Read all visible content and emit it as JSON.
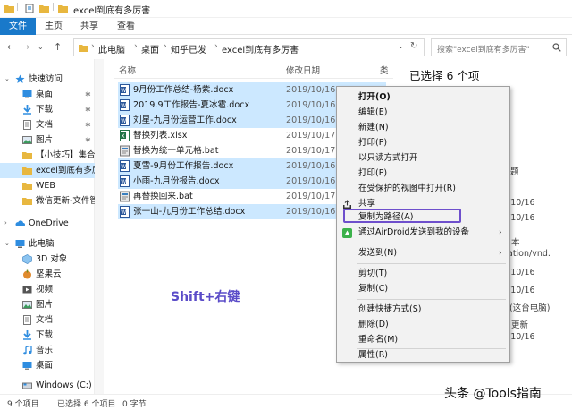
{
  "window": {
    "title": "excel到底有多厉害"
  },
  "ribbon": {
    "tabs": [
      "文件",
      "主页",
      "共享",
      "查看"
    ]
  },
  "address": {
    "crumbs": [
      "此电脑",
      "桌面",
      "知乎已发",
      "excel到底有多厉害"
    ],
    "search_placeholder": "搜索\"excel到底有多厉害\""
  },
  "nav": {
    "items": [
      {
        "label": "快速访问",
        "icon": "star-icon"
      },
      {
        "label": "桌面",
        "icon": "desktop-icon",
        "pinned": true
      },
      {
        "label": "下载",
        "icon": "download-icon",
        "pinned": true
      },
      {
        "label": "文档",
        "icon": "document-icon",
        "pinned": true
      },
      {
        "label": "图片",
        "icon": "picture-icon",
        "pinned": true
      },
      {
        "label": "【小技巧】集合",
        "icon": "folder-icon"
      },
      {
        "label": "excel到底有多厉",
        "icon": "folder-icon",
        "selected": true
      },
      {
        "label": "WEB",
        "icon": "folder-icon"
      },
      {
        "label": "微信更新-文件管",
        "icon": "folder-icon"
      },
      {
        "label": "OneDrive",
        "icon": "cloud-icon"
      },
      {
        "label": "此电脑",
        "icon": "computer-icon"
      },
      {
        "label": "3D 对象",
        "icon": "cube-icon"
      },
      {
        "label": "坚果云",
        "icon": "nut-cloud-icon"
      },
      {
        "label": "视频",
        "icon": "video-icon"
      },
      {
        "label": "图片",
        "icon": "picture-icon"
      },
      {
        "label": "文档",
        "icon": "document-icon"
      },
      {
        "label": "下载",
        "icon": "download-icon"
      },
      {
        "label": "音乐",
        "icon": "music-icon"
      },
      {
        "label": "桌面",
        "icon": "desktop-icon"
      },
      {
        "label": "Windows (C:)",
        "icon": "drive-icon"
      }
    ]
  },
  "filelist": {
    "columns": {
      "name": "名称",
      "date": "修改日期",
      "type": "类"
    },
    "files": [
      {
        "name": "9月份工作总结-杨紫.docx",
        "date": "2019/10/16 1",
        "kind": "word",
        "selected": true
      },
      {
        "name": "2019.9工作报告-夏冰雹.docx",
        "date": "2019/10/16 1",
        "kind": "word",
        "selected": true
      },
      {
        "name": "刘星-九月份运营工作.docx",
        "date": "2019/10/16 1",
        "kind": "word",
        "selected": true
      },
      {
        "name": "替换列表.xlsx",
        "date": "2019/10/17 0",
        "kind": "excel",
        "selected": false
      },
      {
        "name": "替换为统一单元格.bat",
        "date": "2019/10/17 0",
        "kind": "bat",
        "selected": false
      },
      {
        "name": "夏雪-9月份工作报告.docx",
        "date": "2019/10/16 1",
        "kind": "word",
        "selected": true
      },
      {
        "name": "小雨-九月份报告.docx",
        "date": "2019/10/16 1",
        "kind": "word",
        "selected": true
      },
      {
        "name": "再替换回来.bat",
        "date": "2019/10/17 0",
        "kind": "bat",
        "selected": false
      },
      {
        "name": "张一山-九月份工作总结.docx",
        "date": "2019/10/16 1",
        "kind": "word",
        "selected": true
      }
    ]
  },
  "details": {
    "title": "已选择 6 个项",
    "fragments": [
      "题",
      "/10/16",
      "/10/16",
      "本",
      "ation/vnd.",
      "/10/16",
      "/10/16",
      "(这台电脑)",
      "更新",
      "/10/16"
    ]
  },
  "menu": {
    "items": [
      {
        "label": "打开(O)",
        "bold": true
      },
      {
        "label": "编辑(E)"
      },
      {
        "label": "新建(N)"
      },
      {
        "label": "打印(P)"
      },
      {
        "label": "以只读方式打开"
      },
      {
        "label": "打印(P)"
      },
      {
        "label": "在受保护的视图中打开(R)"
      },
      {
        "label": "共享",
        "icon": "share-icon"
      },
      {
        "label": "复制为路径(A)",
        "highlighted": true
      },
      {
        "label": "通过AirDroid发送到我的设备",
        "icon": "airdroid-icon",
        "submenu": true
      },
      {
        "label": "发送到(N)",
        "submenu": true
      },
      {
        "label": "剪切(T)"
      },
      {
        "label": "复制(C)"
      },
      {
        "label": "创建快捷方式(S)"
      },
      {
        "label": "删除(D)"
      },
      {
        "label": "重命名(M)"
      },
      {
        "label": "属性(R)"
      }
    ],
    "submenu_arrow": "›"
  },
  "annotation": {
    "text": "Shift+右键"
  },
  "status": {
    "count": "9 个项目",
    "selected": "已选择 6 个项目",
    "size": "0 字节"
  },
  "watermark": {
    "text": "头条 @Tools指南"
  },
  "colors": {
    "accent": "#1979ca",
    "selection": "#cce8ff",
    "highlight_border": "#6e4fcc"
  }
}
